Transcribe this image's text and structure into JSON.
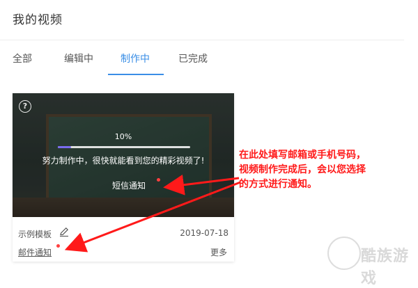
{
  "page": {
    "title": "我的视频"
  },
  "tabs": [
    {
      "label": "全部",
      "active": false
    },
    {
      "label": "编辑中",
      "active": false
    },
    {
      "label": "制作中",
      "active": true
    },
    {
      "label": "已完成",
      "active": false
    }
  ],
  "card": {
    "progress": {
      "label": "10%",
      "fraction": 0.1
    },
    "status_text": "努力制作中，很快就能看到您的精彩视频了!",
    "sms_notify_label": "短信通知",
    "template_name": "示例模板",
    "date": "2019-07-18",
    "mail_notify_label": "邮件通知",
    "more_label": "更多"
  },
  "annotation": {
    "lines": [
      "在此处填写邮箱或手机号码，",
      "视频制作完成后，会以您选择",
      "的方式进行通知。"
    ]
  },
  "watermark": {
    "text": "酷族游戏"
  },
  "colors": {
    "accent": "#3a8ee6",
    "annotation": "#ff1a1a",
    "progress": "#7a6cf0"
  },
  "icons": {
    "help": "question-circle-icon",
    "edit": "pencil-icon"
  }
}
